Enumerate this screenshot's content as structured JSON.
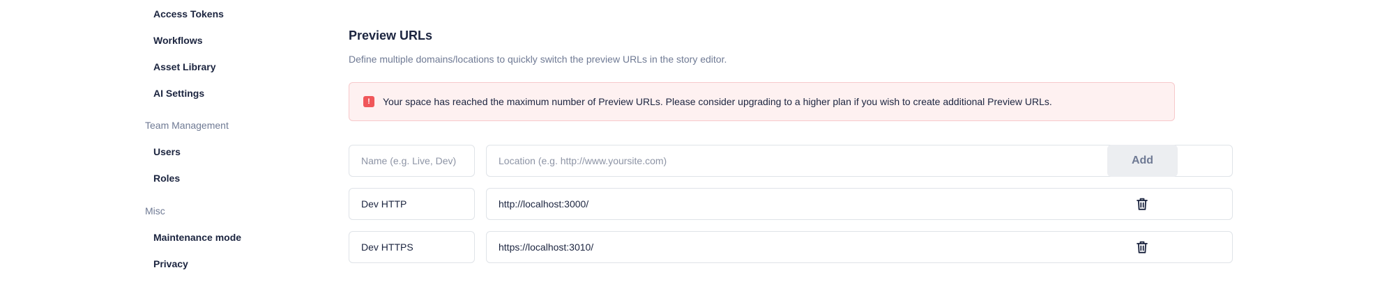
{
  "sidebar": {
    "items_top": [
      {
        "label": "Access Tokens"
      },
      {
        "label": "Workflows"
      },
      {
        "label": "Asset Library"
      },
      {
        "label": "AI Settings"
      }
    ],
    "team_management": {
      "heading": "Team Management",
      "items": [
        {
          "label": "Users"
        },
        {
          "label": "Roles"
        }
      ]
    },
    "misc": {
      "heading": "Misc",
      "items": [
        {
          "label": "Maintenance mode"
        },
        {
          "label": "Privacy"
        }
      ]
    }
  },
  "main": {
    "title": "Preview URLs",
    "description": "Define multiple domains/locations to quickly switch the preview URLs in the story editor.",
    "alert": {
      "icon": "exclamation-icon",
      "text": "Your space has reached the maximum number of Preview URLs. Please consider upgrading to a higher plan if you wish to create additional Preview URLs.",
      "color": "#f0575a"
    },
    "new_entry": {
      "name_placeholder": "Name (e.g. Live, Dev)",
      "location_placeholder": "Location (e.g. http://www.yoursite.com)",
      "add_label": "Add"
    },
    "entries": [
      {
        "name": "Dev HTTP",
        "location": "http://localhost:3000/",
        "delete_icon": "trash-icon"
      },
      {
        "name": "Dev HTTPS",
        "location": "https://localhost:3010/",
        "delete_icon": "trash-icon"
      }
    ]
  }
}
